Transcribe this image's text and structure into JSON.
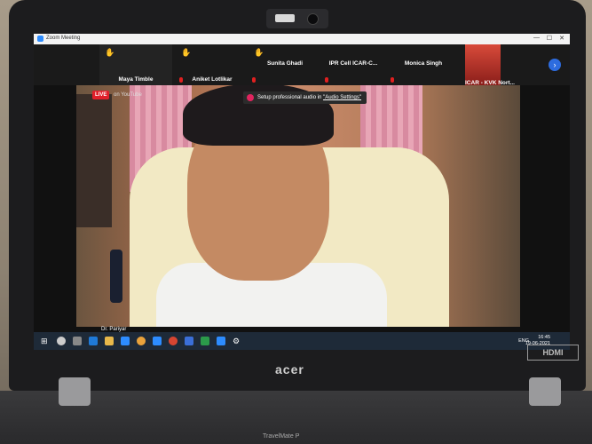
{
  "window": {
    "title": "Zoom Meeting",
    "controls": [
      "—",
      "☐",
      "✕"
    ]
  },
  "participants": [
    {
      "name": "Maya Timble",
      "hand": true,
      "muted": false
    },
    {
      "name": "Aniket Lotlikar",
      "hand": true,
      "muted": true
    },
    {
      "name": "Sunita Ghadi",
      "hand": true,
      "muted": true
    },
    {
      "name": "IPR Cell ICAR-C...",
      "hand": false,
      "muted": true
    },
    {
      "name": "Monica Singh",
      "hand": false,
      "muted": true
    },
    {
      "name": "ICAR - KVK Nort...",
      "hand": false,
      "muted": false
    }
  ],
  "banner": {
    "text": "Setup professional audio in",
    "link": "\"Audio Settings\""
  },
  "stream": {
    "live": "LIVE",
    "platform": "on YouTube"
  },
  "speaker_label": "Dr. Pariyar",
  "tray": {
    "lang": "ENG",
    "time": "16:45",
    "date": "19-06-2021"
  },
  "brand": {
    "logo": "acer",
    "port": "HDMI",
    "model": "TravelMate P"
  },
  "accent": "#2d8cff"
}
